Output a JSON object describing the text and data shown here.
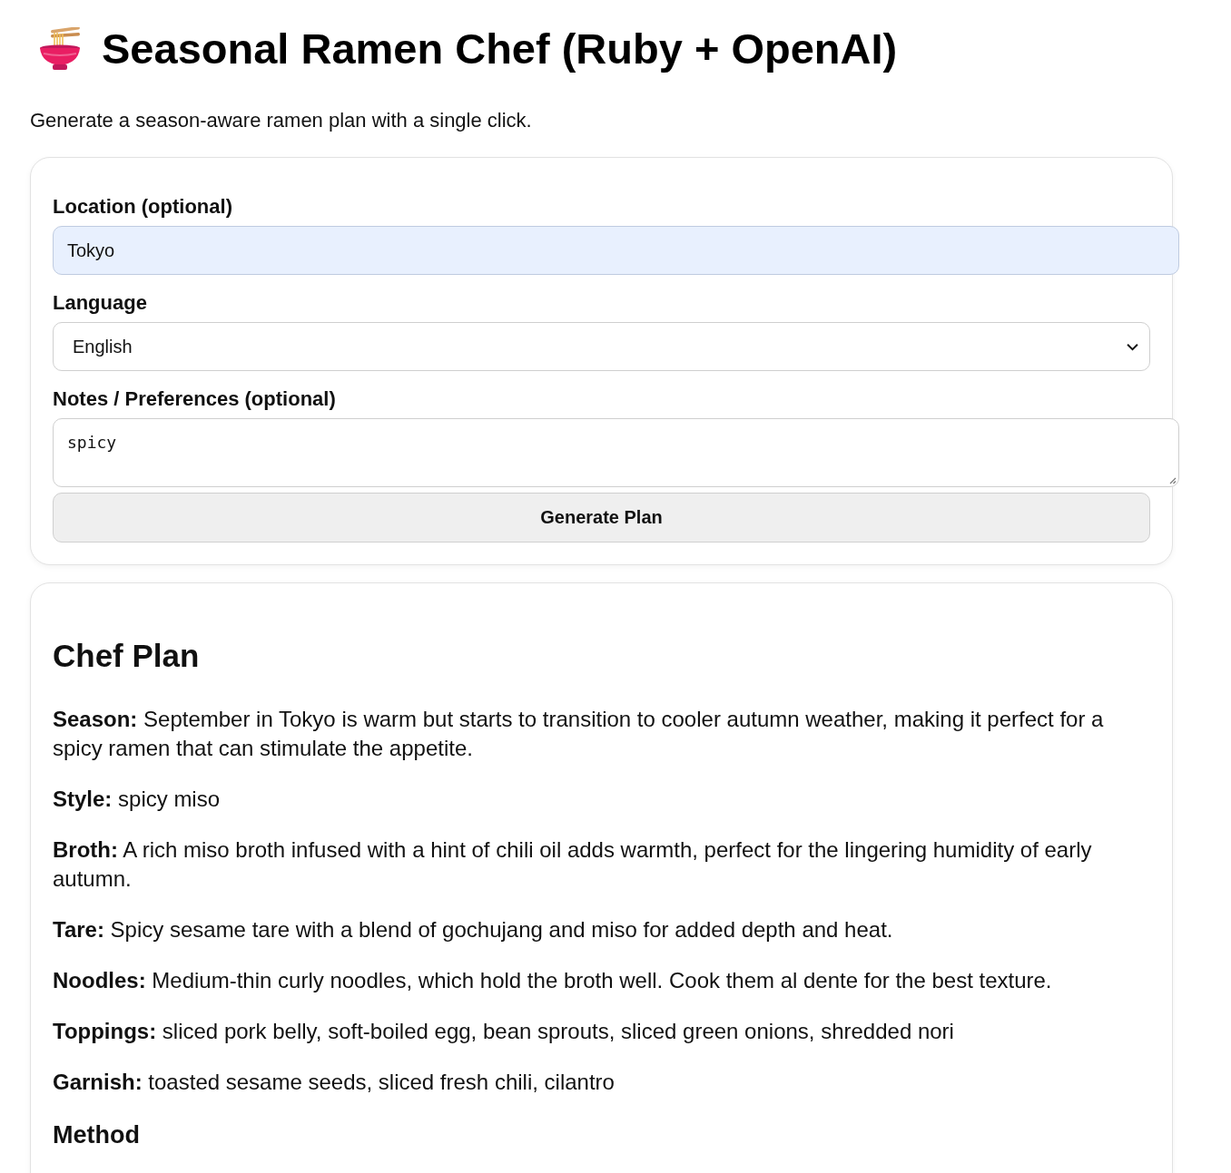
{
  "header": {
    "title": "Seasonal Ramen Chef (Ruby + OpenAI)",
    "subtitle": "Generate a season-aware ramen plan with a single click."
  },
  "form": {
    "fields": [
      {
        "kind": "text",
        "label": "Location (optional)",
        "value": "Tokyo",
        "autofilled": true
      },
      {
        "kind": "select",
        "label": "Language",
        "value": "English",
        "autofilled": false
      },
      {
        "kind": "textarea",
        "label": "Notes / Preferences (optional)",
        "value": "spicy",
        "autofilled": false
      }
    ],
    "button": "Generate Plan"
  },
  "plan": {
    "heading": "Chef Plan",
    "items": [
      "**Season:** September in Tokyo is warm but starts to transition to cooler autumn weather, making it perfect for a spicy ramen that can stimulate the appetite.",
      "**Style:** spicy miso",
      "**Broth:** A rich miso broth infused with a hint of chili oil adds warmth, perfect for the lingering humidity of early autumn.",
      "**Tare:** Spicy sesame tare with a blend of gochujang and miso for added depth and heat.",
      "**Noodles:** Medium-thin curly noodles, which hold the broth well. Cook them al dente for the best texture.",
      "**Toppings:** sliced pork belly, soft-boiled egg, bean sprouts, sliced green onions, shredded nori",
      "**Garnish:** toasted sesame seeds, sliced fresh chili, cilantro"
    ],
    "subheading": "Method"
  }
}
